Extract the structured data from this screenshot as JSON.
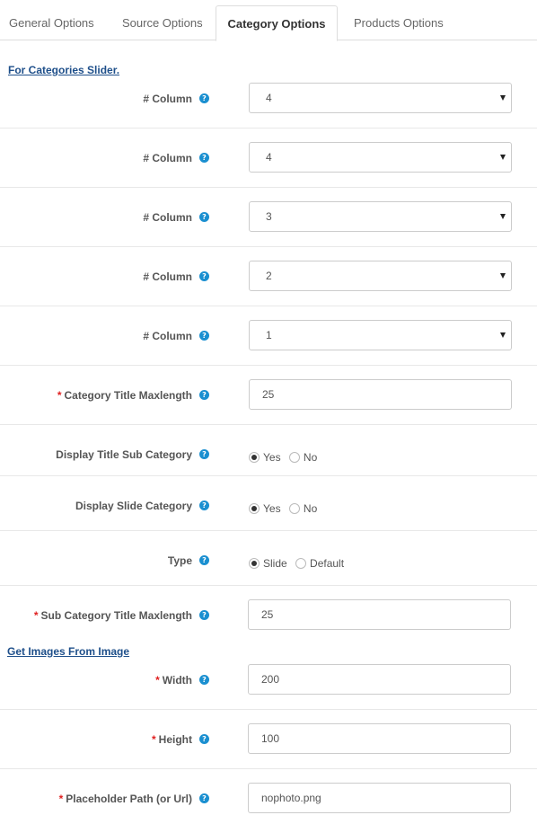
{
  "tabs": [
    {
      "label": "General Options"
    },
    {
      "label": "Source Options"
    },
    {
      "label": "Category Options",
      "active": true
    },
    {
      "label": "Products Options"
    }
  ],
  "section_slider": "For Categories Slider.",
  "section_images": "Get Images From Image",
  "help_glyph": "?",
  "required_mark": "*",
  "fields": {
    "column1": {
      "label": "# Column",
      "value": "4"
    },
    "column2": {
      "label": "# Column",
      "value": "4"
    },
    "column3": {
      "label": "# Column",
      "value": "3"
    },
    "column4": {
      "label": "# Column",
      "value": "2"
    },
    "column5": {
      "label": "# Column",
      "value": "1"
    },
    "cat_title_maxlength": {
      "label": "Category Title Maxlength",
      "value": "25"
    },
    "display_title_sub": {
      "label": "Display Title Sub Category",
      "opt1": "Yes",
      "opt2": "No",
      "selected": "Yes"
    },
    "display_slide": {
      "label": "Display Slide Category",
      "opt1": "Yes",
      "opt2": "No",
      "selected": "Yes"
    },
    "type": {
      "label": "Type",
      "opt1": "Slide",
      "opt2": "Default",
      "selected": "Slide"
    },
    "sub_title_maxlength": {
      "label": "Sub Category Title Maxlength",
      "value": "25"
    },
    "width": {
      "label": "Width",
      "value": "200"
    },
    "height": {
      "label": "Height",
      "value": "100"
    },
    "placeholder": {
      "label": "Placeholder Path (or Url)",
      "value": "nophoto.png"
    }
  },
  "colors": {
    "accent": "#1a8fd0",
    "link": "#1e4f8a",
    "required": "#e02020"
  }
}
